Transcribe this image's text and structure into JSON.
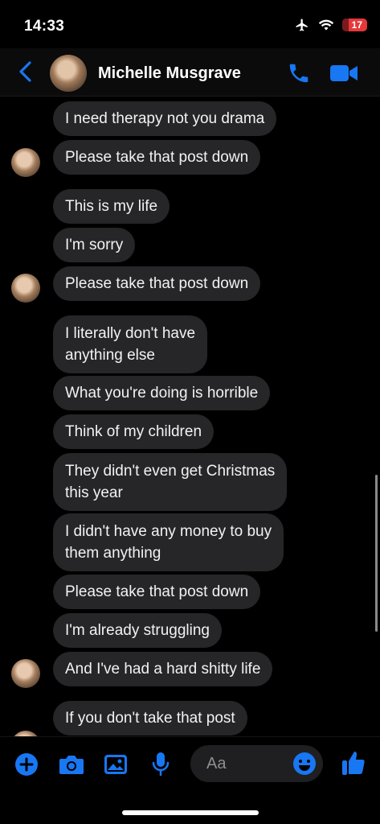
{
  "status": {
    "time": "14:33",
    "battery": "17",
    "icons": [
      "airplane-icon",
      "wifi-icon",
      "battery-icon"
    ]
  },
  "header": {
    "contact_name": "Michelle Musgrave",
    "icons": [
      "back-icon",
      "phone-icon",
      "video-icon"
    ]
  },
  "messages": [
    {
      "text": "I need therapy not you drama"
    },
    {
      "text": "Please take that post down"
    },
    {
      "text": "This is my life"
    },
    {
      "text": "I'm sorry"
    },
    {
      "text": "Please take that post down"
    },
    {
      "text": "I literally don't have"
    },
    {
      "text": "anything else"
    },
    {
      "text": "What you're doing is horrible"
    },
    {
      "text": "Think of my children"
    },
    {
      "text": "They didn't even get Christmas"
    },
    {
      "text": "this year"
    },
    {
      "text": "I didn't have any money to buy"
    },
    {
      "text": "them anything"
    },
    {
      "text": "Please take that post down"
    },
    {
      "text": "I'm already struggling"
    },
    {
      "text": "And I've had a hard shitty life"
    },
    {
      "text": "If you don't take that post"
    }
  ],
  "composer": {
    "placeholder": "Aa",
    "icons": [
      "plus-icon",
      "camera-icon",
      "image-icon",
      "microphone-icon",
      "emoji-icon",
      "thumbs-up-icon"
    ]
  },
  "colors": {
    "accent": "#1877f2",
    "bubble": "#262628",
    "background": "#000000"
  }
}
